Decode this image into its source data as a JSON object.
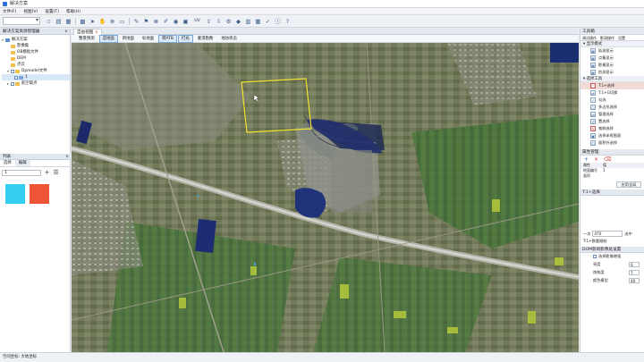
{
  "app": {
    "title": "解决方案"
  },
  "menu": [
    "文件(F)",
    "视图(V)",
    "设置(T)",
    "帮助(H)"
  ],
  "toolbar": {
    "layer_select": "",
    "icons": [
      "new-icon",
      "open-icon",
      "save-icon",
      "grid-icon",
      "pointer-icon",
      "hand-icon",
      "zoom-icon",
      "ruler-icon",
      "brush-icon",
      "flag-icon",
      "layers-icon",
      "pen-icon",
      "globe-icon",
      "image-icon",
      "export-icon",
      "download-icon",
      "settings-icon"
    ],
    "uv_label": "UV"
  },
  "solution_panel": {
    "title": "解决方案资源管理器",
    "items": [
      {
        "label": "解决方案",
        "level": 0
      },
      {
        "label": "影像集",
        "level": 1
      },
      {
        "label": "OB模板文件",
        "level": 1
      },
      {
        "label": "DEM",
        "level": 1
      },
      {
        "label": "点云",
        "level": 1
      },
      {
        "label": "Dpmodel文件",
        "level": 1
      },
      {
        "label": "1",
        "level": 2
      },
      {
        "label": "航空取点",
        "level": 1
      }
    ]
  },
  "layer_panel": {
    "title": "列表",
    "tabs": [
      "选择",
      "编辑"
    ],
    "select_value": "1",
    "swatches": [
      "#35cdf0",
      "#ee5436"
    ]
  },
  "view": {
    "tab": "自由视图",
    "modes": [
      "整景预测",
      "选地面",
      "阴地面",
      "标地面",
      "转ATB",
      "打光",
      "蒙漠勘数",
      "地坊状态"
    ],
    "active_mode": "选地面"
  },
  "tools_panel": {
    "title": "工具箱",
    "tabs": [
      "调试操作",
      "影测操作",
      "设置"
    ],
    "section_display": "显示模式",
    "display_items": [
      "轨测显示",
      "点集显示",
      "影模显示",
      "阶测显示"
    ],
    "section_select": "选择工具",
    "select_items": [
      "T:1+选择",
      "T:1+G切换",
      "勾选",
      "多边形选择",
      "管理选择",
      "置选择",
      "笔刷选择",
      "选择半框图面",
      "面积外选择"
    ],
    "prop_title": "属性管理",
    "prop_rows": [
      {
        "k": "属性",
        "v": "值"
      },
      {
        "k": "地面编号",
        "v": "1"
      },
      {
        "k": "面积",
        "v": ""
      }
    ],
    "apply_btn": "应用全局",
    "sub_title": "T:1+选择",
    "range_label": "一次",
    "range_value": "470",
    "range_btn": "选中",
    "limit_label": "T:1+数量限制",
    "section_dom": "DOM影响影像处设置",
    "dom_checkbox": "选择影像增强",
    "dom_rows": [
      {
        "k": "亮度",
        "v": "6"
      },
      {
        "k": "饱和度",
        "v": "7"
      },
      {
        "k": "颜色模型",
        "v": "40"
      }
    ]
  },
  "status": {
    "text": "空间坐标: 大地坐标"
  }
}
